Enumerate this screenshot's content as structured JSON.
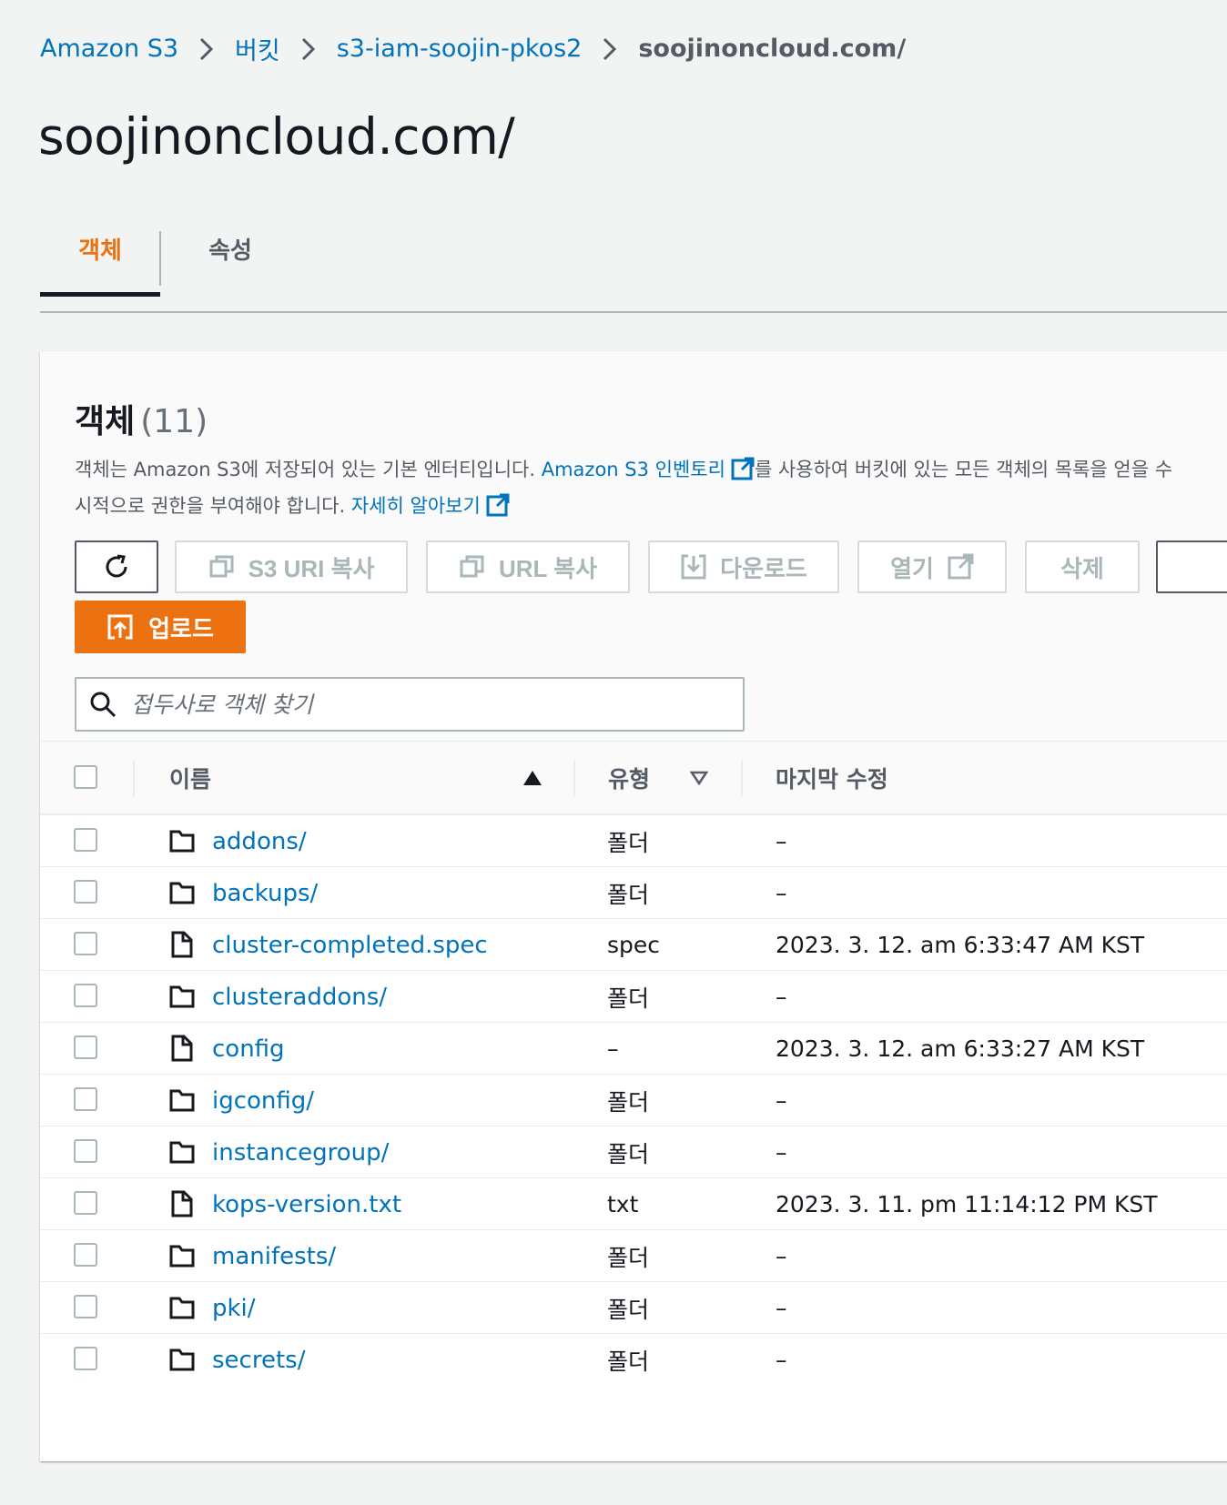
{
  "breadcrumb": {
    "items": [
      {
        "label": "Amazon S3"
      },
      {
        "label": "버킷"
      },
      {
        "label": "s3-iam-soojin-pkos2"
      },
      {
        "label": "soojinoncloud.com/"
      }
    ]
  },
  "page": {
    "title": "soojinoncloud.com/"
  },
  "tabs": [
    {
      "label": "객체",
      "active": true
    },
    {
      "label": "속성",
      "active": false
    }
  ],
  "panel": {
    "title": "객체",
    "count": "(11)",
    "desc_part1": "객체는 Amazon S3에 저장되어 있는 기본 엔터티입니다. ",
    "desc_link1": "Amazon S3 인벤토리",
    "desc_part2": "를 사용하여 버킷에 있는 모든 객체의 목록을 얻을 수",
    "desc_part3": "시적으로 권한을 부여해야 합니다. ",
    "desc_link2": "자세히 알아보기"
  },
  "toolbar": {
    "refresh_icon": "refresh-icon",
    "s3uri_label": "S3 URI 복사",
    "url_label": "URL 복사",
    "download_label": "다운로드",
    "open_label": "열기",
    "delete_label": "삭제",
    "upload_label": "업로드"
  },
  "search": {
    "placeholder": "접두사로 객체 찾기",
    "value": ""
  },
  "table": {
    "columns": {
      "name": "이름",
      "type": "유형",
      "modified": "마지막 수정"
    },
    "sort": {
      "column": "이름",
      "direction": "asc"
    },
    "rows": [
      {
        "icon": "folder-icon",
        "name": "addons/",
        "type": "폴더",
        "modified": "–"
      },
      {
        "icon": "folder-icon",
        "name": "backups/",
        "type": "폴더",
        "modified": "–"
      },
      {
        "icon": "file-icon",
        "name": "cluster-completed.spec",
        "type": "spec",
        "modified": "2023. 3. 12. am 6:33:47 AM KST"
      },
      {
        "icon": "folder-icon",
        "name": "clusteraddons/",
        "type": "폴더",
        "modified": "–"
      },
      {
        "icon": "file-icon",
        "name": "config",
        "type": "–",
        "modified": "2023. 3. 12. am 6:33:27 AM KST"
      },
      {
        "icon": "folder-icon",
        "name": "igconfig/",
        "type": "폴더",
        "modified": "–"
      },
      {
        "icon": "folder-icon",
        "name": "instancegroup/",
        "type": "폴더",
        "modified": "–"
      },
      {
        "icon": "file-icon",
        "name": "kops-version.txt",
        "type": "txt",
        "modified": "2023. 3. 11. pm 11:14:12 PM KST"
      },
      {
        "icon": "folder-icon",
        "name": "manifests/",
        "type": "폴더",
        "modified": "–"
      },
      {
        "icon": "folder-icon",
        "name": "pki/",
        "type": "폴더",
        "modified": "–"
      },
      {
        "icon": "folder-icon",
        "name": "secrets/",
        "type": "폴더",
        "modified": "–"
      }
    ]
  },
  "colors": {
    "link": "#0073bb",
    "accent": "#ec7211",
    "text": "#16191f",
    "muted": "#545b64",
    "background": "#f2f3f3"
  }
}
